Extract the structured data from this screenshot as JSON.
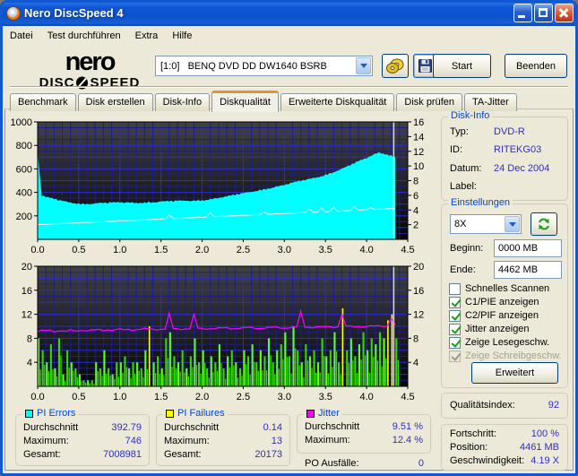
{
  "window": {
    "title": "Nero DiscSpeed 4"
  },
  "menu": {
    "items": [
      "Datei",
      "Test durchführen",
      "Extra",
      "Hilfe"
    ]
  },
  "toolbar": {
    "logo_top": "nero",
    "logo_bottom_left": "DISC",
    "logo_bottom_right": "SPEED",
    "drive_selector": "[1:0]   BENQ DVD DD DW1640 BSRB",
    "start_label": "Start",
    "quit_label": "Beenden"
  },
  "tabs": {
    "active_index": 3,
    "items": [
      {
        "label": "Benchmark"
      },
      {
        "label": "Disk erstellen"
      },
      {
        "label": "Disk-Info"
      },
      {
        "label": "Diskqualität"
      },
      {
        "label": "Erweiterte Diskqualität"
      },
      {
        "label": "Disk prüfen"
      },
      {
        "label": "TA-Jitter"
      }
    ]
  },
  "disk_info": {
    "title": "Disk-Info",
    "rows": [
      {
        "label": "Typ:",
        "value": "DVD-R"
      },
      {
        "label": "ID:",
        "value": "RITEKG03"
      },
      {
        "label": "Datum:",
        "value": "24 Dec 2004"
      },
      {
        "label": "Label:",
        "value": ""
      }
    ]
  },
  "settings": {
    "title": "Einstellungen",
    "speed_value": "8X",
    "begin_label": "Beginn:",
    "begin_value": "0000 MB",
    "end_label": "Ende:",
    "end_value": "4462 MB",
    "checkboxes": [
      {
        "label": "Schnelles Scannen",
        "checked": false,
        "disabled": false
      },
      {
        "label": "C1/PIE anzeigen",
        "checked": true,
        "disabled": false
      },
      {
        "label": "C2/PIF anzeigen",
        "checked": true,
        "disabled": false
      },
      {
        "label": "Jitter anzeigen",
        "checked": true,
        "disabled": false
      },
      {
        "label": "Zeige Lesegeschw.",
        "checked": true,
        "disabled": false
      },
      {
        "label": "Zeige Schreibgeschw.",
        "checked": true,
        "disabled": true
      }
    ],
    "advanced_label": "Erweitert"
  },
  "quality": {
    "label": "Qualitätsindex:",
    "value": "92"
  },
  "progress": {
    "rows": [
      {
        "label": "Fortschritt:",
        "value": "100 %"
      },
      {
        "label": "Position:",
        "value": "4461 MB"
      },
      {
        "label": "Geschwindigkeit:",
        "value": "4.19 X"
      }
    ]
  },
  "stats": {
    "groups": [
      {
        "title": "PI Errors",
        "swatch": "#00ffff",
        "rows": [
          {
            "label": "Durchschnitt",
            "value": "392.79"
          },
          {
            "label": "Maximum:",
            "value": "746"
          },
          {
            "label": "Gesamt:",
            "value": "7008981"
          }
        ]
      },
      {
        "title": "PI Failures",
        "swatch": "#ffff00",
        "rows": [
          {
            "label": "Durchschnitt",
            "value": "0.14"
          },
          {
            "label": "Maximum:",
            "value": "13"
          },
          {
            "label": "Gesamt:",
            "value": "20173"
          }
        ]
      },
      {
        "title": "Jitter",
        "swatch": "#ff00ff",
        "rows": [
          {
            "label": "Durchschnitt",
            "value": "9.51 %"
          },
          {
            "label": "Maximum:",
            "value": "12.4 %"
          }
        ]
      }
    ],
    "po_label": "PO Ausfälle:",
    "po_value": "0"
  },
  "colors": {
    "accent_orange": "#E5942C",
    "value_blue": "#2F2FC1",
    "caption_blue": "#0046D5",
    "plot_top": "#414141",
    "plot_bottom": "#060606",
    "grid_minor": "#1d1d8a",
    "grid_major": "#2b2bdd",
    "cursor": "#d9d9d9"
  },
  "chart_data": [
    {
      "type": "area",
      "name": "PI Errors und Lesegeschwindigkeit",
      "x_range": [
        0,
        4.5
      ],
      "x_tick_step": 0.5,
      "x_tick_labels": [
        "0.0",
        "0.5",
        "1.0",
        "1.5",
        "2.0",
        "2.5",
        "3.0",
        "3.5",
        "4.0",
        "4.5"
      ],
      "left_axis": {
        "range": [
          0,
          1000
        ],
        "ticks": [
          200,
          400,
          600,
          800,
          1000
        ]
      },
      "right_axis": {
        "range": [
          0,
          16
        ],
        "ticks": [
          2,
          4,
          6,
          8,
          10,
          12,
          14,
          16
        ]
      },
      "grid": {
        "x_minor": 0.1,
        "x_major": 0.5,
        "y_minor": 50,
        "y_major": 100
      },
      "cursor_x": 4.33,
      "series": [
        {
          "name": "PI Errors",
          "type": "area",
          "axis": "left",
          "color": "#00ffff",
          "x_start": 0,
          "x_step": 0.05,
          "values": [
            745,
            372,
            358,
            349,
            341,
            333,
            327,
            320,
            315,
            311,
            307,
            304,
            303,
            304,
            306,
            307,
            309,
            308,
            311,
            310,
            313,
            312,
            315,
            314,
            312,
            316,
            315,
            318,
            317,
            319,
            321,
            320,
            323,
            322,
            326,
            325,
            329,
            328,
            331,
            333,
            336,
            339,
            344,
            348,
            353,
            358,
            363,
            369,
            376,
            383,
            391,
            398,
            406,
            413,
            421,
            428,
            436,
            442,
            449,
            455,
            462,
            470,
            479,
            487,
            496,
            504,
            513,
            522,
            531,
            541,
            552,
            563,
            575,
            588,
            601,
            615,
            630,
            645,
            661,
            676,
            691,
            710,
            728,
            741,
            735,
            726,
            714,
            698
          ]
        },
        {
          "name": "Lesegeschwindigkeit",
          "type": "trend",
          "axis": "right",
          "color": "#ffffff",
          "x_start": 0,
          "x_end": 4.35,
          "x_step": 0.05,
          "y_start": 2.0,
          "y_end": 4.2,
          "spikes": [
            [
              1.62,
              0.5
            ],
            [
              2.1,
              0.55
            ],
            [
              2.75,
              0.3
            ],
            [
              3.3,
              0.45
            ],
            [
              3.45,
              0.55
            ],
            [
              3.62,
              0.5
            ],
            [
              3.85,
              0.5
            ],
            [
              4.05,
              0.3
            ]
          ]
        }
      ]
    },
    {
      "type": "bar",
      "name": "PI Failures und Jitter",
      "x_range": [
        0,
        4.5
      ],
      "x_tick_step": 0.5,
      "x_tick_labels": [
        "0.0",
        "0.5",
        "1.0",
        "1.5",
        "2.0",
        "2.5",
        "3.0",
        "3.5",
        "4.0",
        "4.5"
      ],
      "left_axis": {
        "range": [
          0,
          20
        ],
        "ticks": [
          4,
          8,
          12,
          16,
          20
        ]
      },
      "right_axis": {
        "range": [
          0,
          20
        ],
        "ticks": [
          4,
          8,
          12,
          16,
          20
        ]
      },
      "grid": {
        "x_minor": 0.1,
        "x_major": 0.5,
        "y_minor": 1,
        "y_major": 2
      },
      "cursor_x": 4.33,
      "series": [
        {
          "name": "PI Failures",
          "type": "bars",
          "axis": "left",
          "color": "#35d800",
          "color2": "#5dff1f",
          "highlight_color": "#ffff00",
          "highlight_indices": [
            27,
            74,
            85,
            86
          ],
          "x_start": 0,
          "x_step": 0.05,
          "values": [
            8,
            6,
            4,
            7,
            3,
            8,
            2,
            6,
            4,
            3,
            2,
            1,
            1,
            1,
            4,
            3,
            6,
            3,
            2,
            4,
            4,
            5,
            3,
            4,
            4,
            3,
            6,
            10,
            4,
            5,
            3,
            8,
            9,
            5,
            4,
            6,
            3,
            5,
            8,
            4,
            6,
            3,
            5,
            4,
            7,
            3,
            5,
            6,
            4,
            3,
            6,
            5,
            7,
            4,
            6,
            5,
            8,
            4,
            6,
            7,
            9,
            5,
            10,
            6,
            4,
            7,
            5,
            6,
            4,
            8,
            5,
            6,
            9,
            4,
            13,
            6,
            8,
            5,
            7,
            9,
            6,
            8,
            7,
            9,
            8,
            11,
            12,
            8
          ]
        },
        {
          "name": "Jitter",
          "type": "line",
          "axis": "left",
          "color": "#ff00ff",
          "x_start": 0,
          "x_step": 0.05,
          "values": [
            9.1,
            9.3,
            9.2,
            9.4,
            9.15,
            9.3,
            9.25,
            9.1,
            9.35,
            9.2,
            9.3,
            9.4,
            9.25,
            9.35,
            9.3,
            9.45,
            9.3,
            9.5,
            9.35,
            9.4,
            9.5,
            9.35,
            9.55,
            9.4,
            9.5,
            9.45,
            9.6,
            9.5,
            9.55,
            9.45,
            9.6,
            9.5,
            12.1,
            9.55,
            9.6,
            9.5,
            9.65,
            9.55,
            11.9,
            9.6,
            9.65,
            9.55,
            9.7,
            9.6,
            9.7,
            9.65,
            9.75,
            9.6,
            9.7,
            9.65,
            9.75,
            9.7,
            9.8,
            9.65,
            9.75,
            9.7,
            9.8,
            9.75,
            9.85,
            9.7,
            9.8,
            9.75,
            9.85,
            9.8,
            12.4,
            9.85,
            9.9,
            9.8,
            9.95,
            9.85,
            9.9,
            9.95,
            9.85,
            10.0,
            12.0,
            9.95,
            10.0,
            9.9,
            10.05,
            9.95,
            10.0,
            10.05,
            9.95,
            10.1,
            10.0,
            10.15,
            11.3,
            10.2
          ]
        }
      ]
    }
  ]
}
